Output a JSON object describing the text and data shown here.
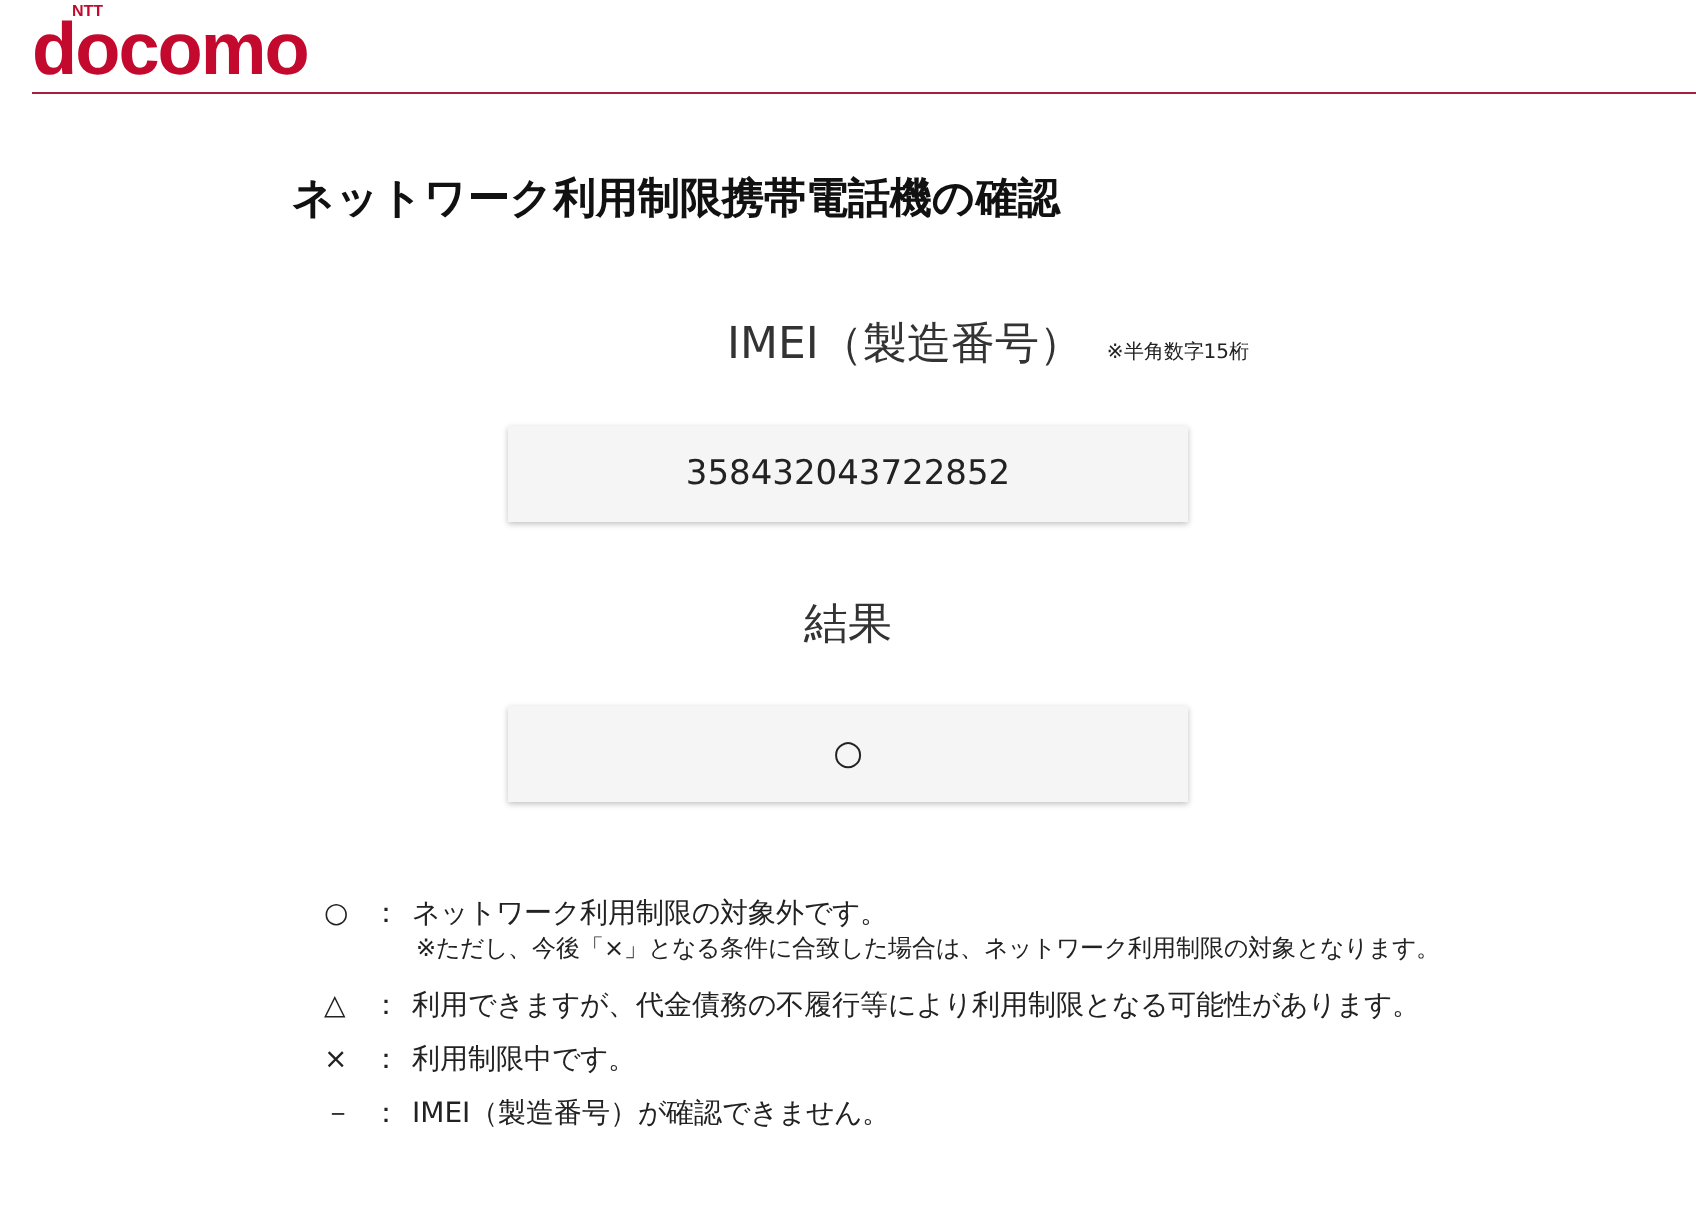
{
  "header": {
    "logo_small": "NTT",
    "logo": "docomo"
  },
  "title": "ネットワーク利用制限携帯電話機の確認",
  "imei": {
    "label": "IMEI（製造番号）",
    "hint": "※半角数字15桁",
    "value": "358432043722852"
  },
  "result": {
    "label": "結果",
    "value": "○"
  },
  "legend": [
    {
      "symbol": "○",
      "colon": "：",
      "text": "ネットワーク利用制限の対象外です。",
      "note": "※ただし、今後「×」となる条件に合致した場合は、ネットワーク利用制限の対象となります。"
    },
    {
      "symbol": "△",
      "colon": "：",
      "text": "利用できますが、代金債務の不履行等により利用制限となる可能性があります。"
    },
    {
      "symbol": "×",
      "colon": "：",
      "text": "利用制限中です。"
    },
    {
      "symbol": "－",
      "colon": "：",
      "text": "IMEI（製造番号）が確認できません。"
    }
  ]
}
